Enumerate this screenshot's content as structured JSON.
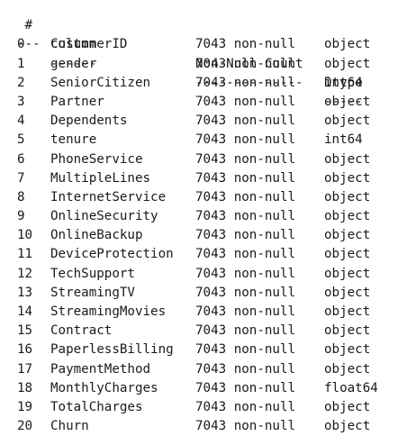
{
  "header": {
    "index": " #",
    "column": "Column",
    "count": "Non-Null Count",
    "dtype": "Dtype"
  },
  "separator": {
    "index": "---",
    "column": "------",
    "count": "--------------",
    "dtype": "-----"
  },
  "rows": [
    {
      "index": "0",
      "column": "customerID",
      "count": "7043 non-null",
      "dtype": "object"
    },
    {
      "index": "1",
      "column": "gender",
      "count": "7043 non-null",
      "dtype": "object"
    },
    {
      "index": "2",
      "column": "SeniorCitizen",
      "count": "7043 non-null",
      "dtype": "int64"
    },
    {
      "index": "3",
      "column": "Partner",
      "count": "7043 non-null",
      "dtype": "object"
    },
    {
      "index": "4",
      "column": "Dependents",
      "count": "7043 non-null",
      "dtype": "object"
    },
    {
      "index": "5",
      "column": "tenure",
      "count": "7043 non-null",
      "dtype": "int64"
    },
    {
      "index": "6",
      "column": "PhoneService",
      "count": "7043 non-null",
      "dtype": "object"
    },
    {
      "index": "7",
      "column": "MultipleLines",
      "count": "7043 non-null",
      "dtype": "object"
    },
    {
      "index": "8",
      "column": "InternetService",
      "count": "7043 non-null",
      "dtype": "object"
    },
    {
      "index": "9",
      "column": "OnlineSecurity",
      "count": "7043 non-null",
      "dtype": "object"
    },
    {
      "index": "10",
      "column": "OnlineBackup",
      "count": "7043 non-null",
      "dtype": "object"
    },
    {
      "index": "11",
      "column": "DeviceProtection",
      "count": "7043 non-null",
      "dtype": "object"
    },
    {
      "index": "12",
      "column": "TechSupport",
      "count": "7043 non-null",
      "dtype": "object"
    },
    {
      "index": "13",
      "column": "StreamingTV",
      "count": "7043 non-null",
      "dtype": "object"
    },
    {
      "index": "14",
      "column": "StreamingMovies",
      "count": "7043 non-null",
      "dtype": "object"
    },
    {
      "index": "15",
      "column": "Contract",
      "count": "7043 non-null",
      "dtype": "object"
    },
    {
      "index": "16",
      "column": "PaperlessBilling",
      "count": "7043 non-null",
      "dtype": "object"
    },
    {
      "index": "17",
      "column": "PaymentMethod",
      "count": "7043 non-null",
      "dtype": "object"
    },
    {
      "index": "18",
      "column": "MonthlyCharges",
      "count": "7043 non-null",
      "dtype": "float64"
    },
    {
      "index": "19",
      "column": "TotalCharges",
      "count": "7043 non-null",
      "dtype": "object"
    },
    {
      "index": "20",
      "column": "Churn",
      "count": "7043 non-null",
      "dtype": "object"
    }
  ]
}
